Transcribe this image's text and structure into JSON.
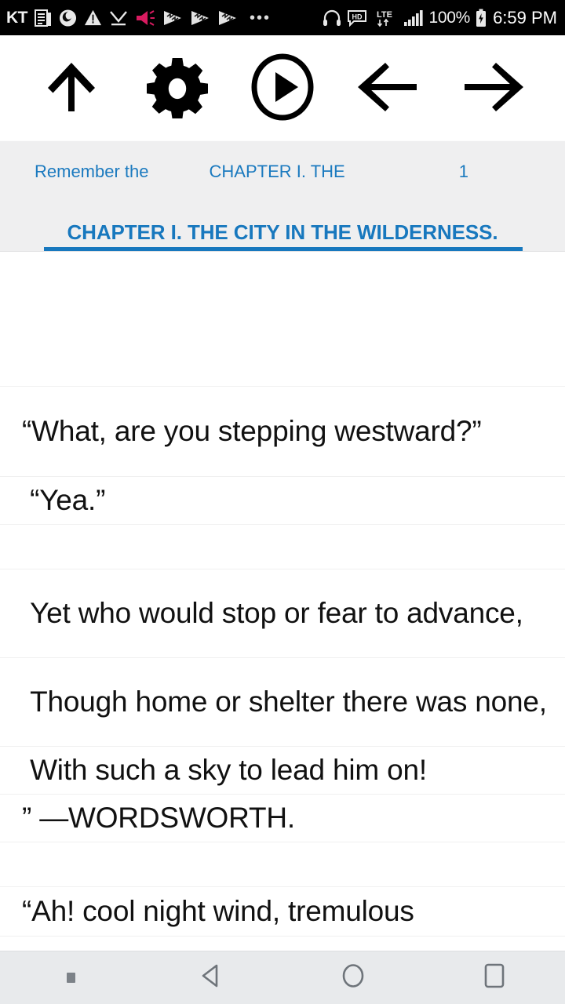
{
  "statusbar": {
    "carrier": "KT",
    "battery_percent": "100%",
    "time": "6:59 PM",
    "network_type": "LTE",
    "hd_label": "HD",
    "overflow": "•••",
    "icons": [
      "carrier-kt-label",
      "news-reader-icon",
      "firefox-icon",
      "warning-triangle-icon",
      "checkmark-download-icon",
      "megaphone-icon",
      "media-play-triangle-icon-1",
      "media-play-triangle-icon-2",
      "media-play-triangle-icon-3",
      "overflow-dots-icon",
      "headphones-icon",
      "hd-voice-icon",
      "lte-data-icon",
      "signal-bars-icon",
      "battery-icon"
    ]
  },
  "toolbar": {
    "buttons": [
      {
        "name": "up-arrow-icon",
        "label": "Up"
      },
      {
        "name": "gear-icon",
        "label": "Settings"
      },
      {
        "name": "play-circle-icon",
        "label": "Play"
      },
      {
        "name": "left-arrow-icon",
        "label": "Previous"
      },
      {
        "name": "right-arrow-icon",
        "label": "Next"
      }
    ]
  },
  "tabs": {
    "secondary": [
      {
        "label": "Remember the"
      },
      {
        "label": "CHAPTER I.   THE"
      },
      {
        "label": "1"
      }
    ],
    "active": {
      "label": "CHAPTER I.   THE CITY IN THE WILDERNESS."
    },
    "accent_color": "#1878be"
  },
  "content": {
    "rows": [
      {
        "text": ""
      },
      {
        "text": "“What, are you stepping westward?”"
      },
      {
        "text": " “Yea.”"
      },
      {
        "text": ""
      },
      {
        "text": " Yet who would stop or fear to advance,"
      },
      {
        "text": " Though home or shelter there was none,"
      },
      {
        "text": " With such a sky to lead him on!"
      },
      {
        "text": "” —WORDSWORTH."
      },
      {
        "text": ""
      },
      {
        "text": "“Ah! cool night wind, tremulous"
      }
    ]
  },
  "navbar": {
    "items": [
      {
        "name": "nav-dot-indicator",
        "label": "Indicator"
      },
      {
        "name": "nav-back-icon",
        "label": "Back"
      },
      {
        "name": "nav-home-icon",
        "label": "Home"
      },
      {
        "name": "nav-recents-icon",
        "label": "Recents"
      }
    ]
  }
}
